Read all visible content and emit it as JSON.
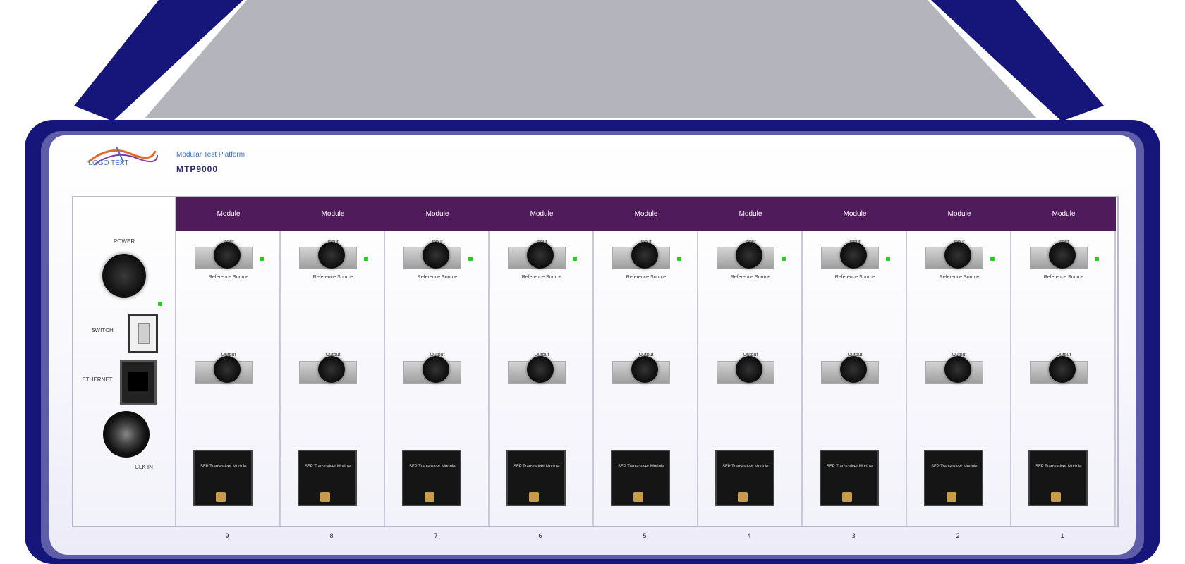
{
  "device": {
    "logo_text": "LOGO TEXT",
    "series": "Modular Test Platform",
    "model": "MTP9000",
    "colors": {
      "frame": "#16167a",
      "top_panel": "#b4b4bc",
      "module_header": "#4f1b5a",
      "led": "#1fd11f",
      "sfp_body": "#151515"
    }
  },
  "control_panel": {
    "knob_label": "POWER",
    "switch_label": "SWITCH",
    "ethernet_label": "ETHERNET",
    "bnc_label": "CLK IN",
    "icons": [
      "power-knob-icon",
      "toggle-switch-icon",
      "ethernet-port-icon",
      "bnc-connector-icon"
    ]
  },
  "modules": [
    {
      "header": "Module",
      "top_port_label": "Input",
      "top_caption": "Reference Source",
      "bottom_port_label": "Output",
      "sfp_text": "SFP Transceiver Module",
      "slot": "9"
    },
    {
      "header": "Module",
      "top_port_label": "Input",
      "top_caption": "Reference Source",
      "bottom_port_label": "Output",
      "sfp_text": "SFP Transceiver Module",
      "slot": "8"
    },
    {
      "header": "Module",
      "top_port_label": "Input",
      "top_caption": "Reference Source",
      "bottom_port_label": "Output",
      "sfp_text": "SFP Transceiver Module",
      "slot": "7"
    },
    {
      "header": "Module",
      "top_port_label": "Input",
      "top_caption": "Reference Source",
      "bottom_port_label": "Output",
      "sfp_text": "SFP Transceiver Module",
      "slot": "6"
    },
    {
      "header": "Module",
      "top_port_label": "Input",
      "top_caption": "Reference Source",
      "bottom_port_label": "Output",
      "sfp_text": "SFP Transceiver Module",
      "slot": "5"
    },
    {
      "header": "Module",
      "top_port_label": "Input",
      "top_caption": "Reference Source",
      "bottom_port_label": "Output",
      "sfp_text": "SFP Transceiver Module",
      "slot": "4"
    },
    {
      "header": "Module",
      "top_port_label": "Input",
      "top_caption": "Reference Source",
      "bottom_port_label": "Output",
      "sfp_text": "SFP Transceiver Module",
      "slot": "3"
    },
    {
      "header": "Module",
      "top_port_label": "Input",
      "top_caption": "Reference Source",
      "bottom_port_label": "Output",
      "sfp_text": "SFP Transceiver Module",
      "slot": "2"
    },
    {
      "header": "Module",
      "top_port_label": "Input",
      "top_caption": "Reference Source",
      "bottom_port_label": "Output",
      "sfp_text": "SFP Transceiver Module",
      "slot": "1"
    }
  ]
}
